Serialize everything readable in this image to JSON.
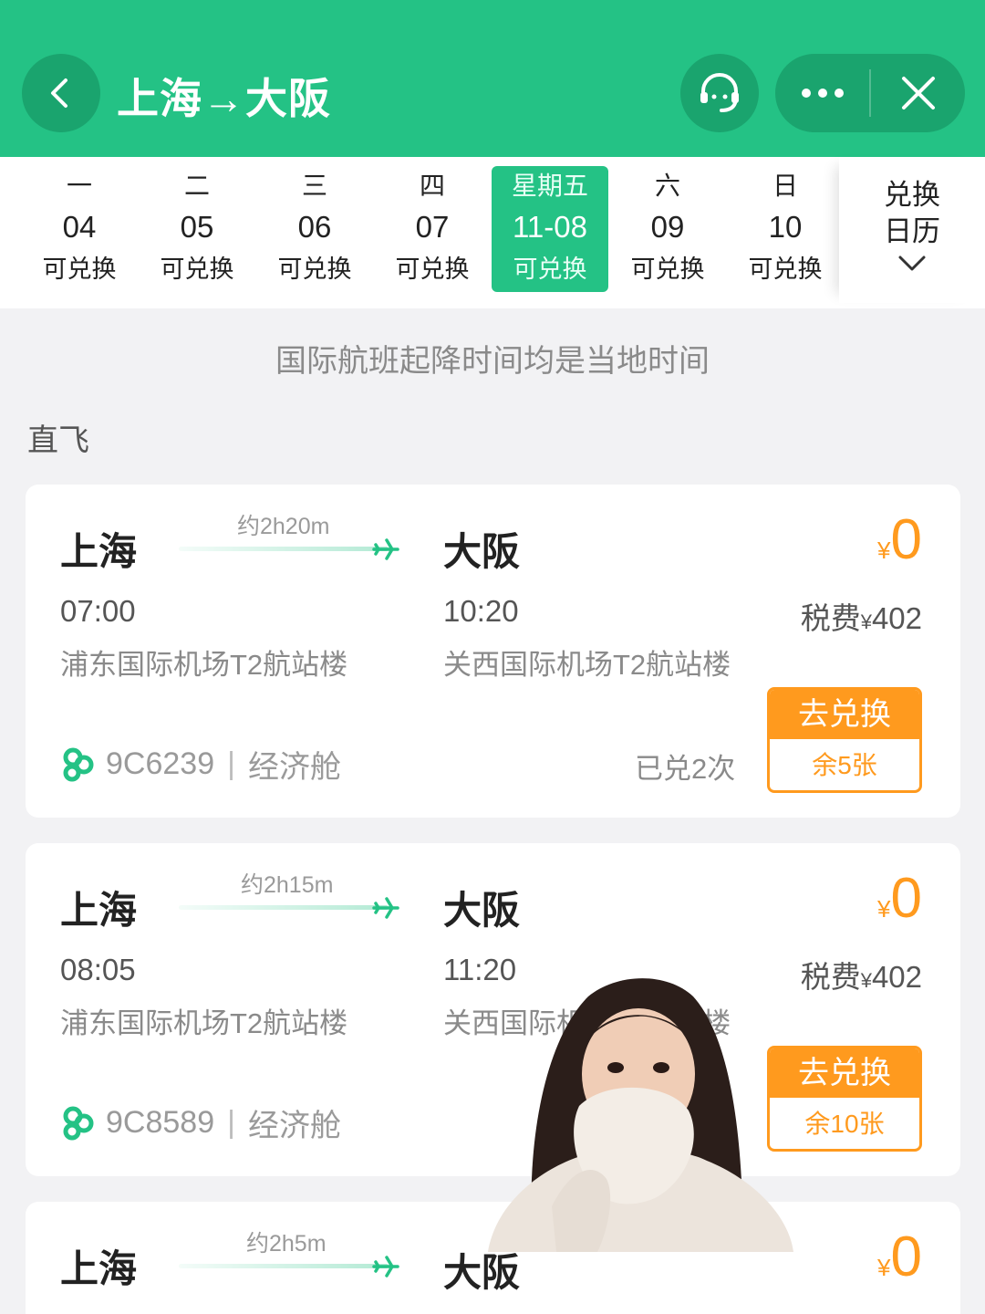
{
  "header": {
    "title": "上海→大阪"
  },
  "dates": [
    {
      "weekday": "一",
      "date": "04",
      "status": "可兑换",
      "active": false
    },
    {
      "weekday": "二",
      "date": "05",
      "status": "可兑换",
      "active": false
    },
    {
      "weekday": "三",
      "date": "06",
      "status": "可兑换",
      "active": false
    },
    {
      "weekday": "四",
      "date": "07",
      "status": "可兑换",
      "active": false
    },
    {
      "weekday": "星期五",
      "date": "11-08",
      "status": "可兑换",
      "active": true
    },
    {
      "weekday": "六",
      "date": "09",
      "status": "可兑换",
      "active": false
    },
    {
      "weekday": "日",
      "date": "10",
      "status": "可兑换",
      "active": false
    }
  ],
  "calendar": {
    "line1": "兑换",
    "line2": "日历"
  },
  "notice": "国际航班起降时间均是当地时间",
  "section_label": "直飞",
  "flights": [
    {
      "from_city": "上海",
      "to_city": "大阪",
      "duration": "约2h20m",
      "price_currency": "¥",
      "price": "0",
      "dep_time": "07:00",
      "arr_time": "10:20",
      "tax_label": "税费",
      "tax_currency": "¥",
      "tax": "402",
      "dep_airport": "浦东国际机场T2航站楼",
      "arr_airport": "关西国际机场T2航站楼",
      "flight_no": "9C6239",
      "cabin": "经济舱",
      "redeemed": "已兑2次",
      "button_label": "去兑换",
      "remaining": "余5张"
    },
    {
      "from_city": "上海",
      "to_city": "大阪",
      "duration": "约2h15m",
      "price_currency": "¥",
      "price": "0",
      "dep_time": "08:05",
      "arr_time": "11:20",
      "tax_label": "税费",
      "tax_currency": "¥",
      "tax": "402",
      "dep_airport": "浦东国际机场T2航站楼",
      "arr_airport": "关西国际机场T2航站楼",
      "flight_no": "9C8589",
      "cabin": "经济舱",
      "button_label": "去兑换",
      "remaining": "余10张"
    },
    {
      "from_city": "上海",
      "to_city": "大阪",
      "duration": "约2h5m",
      "price_currency": "¥",
      "price": "0"
    }
  ],
  "colors": {
    "brand": "#24c285",
    "accent": "#ff9a1e"
  }
}
